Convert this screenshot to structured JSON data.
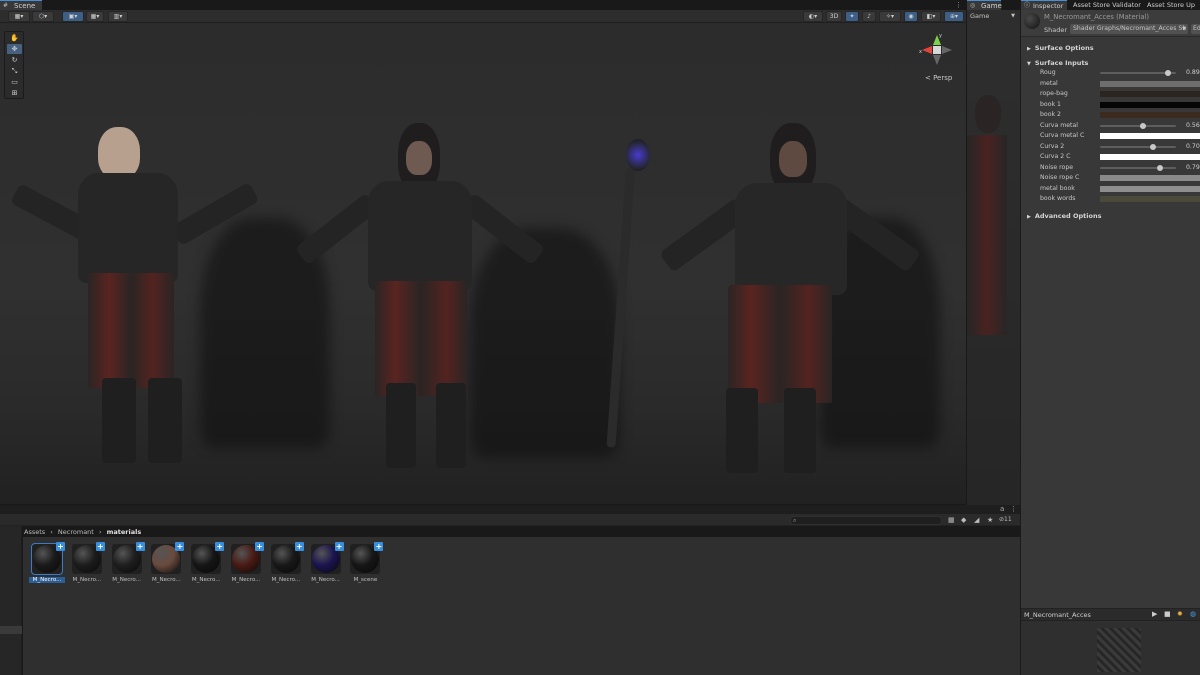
{
  "scene_tab": {
    "label": "Scene"
  },
  "game_tab": {
    "label": "Game",
    "sub_label": "Game"
  },
  "scene_toolbar": {
    "mode_2d_label": "3D"
  },
  "viewport": {
    "projection_label": "< Persp",
    "gizmo_axes": [
      "x",
      "y",
      "z"
    ]
  },
  "inspector": {
    "tabs": [
      "Inspector",
      "Asset Store Validator",
      "Asset Store Up"
    ],
    "material_name": "M_Necromant_Acces (Material)",
    "shader_label": "Shader",
    "shader_value": "Shader Graphs/Necromant_Acces Sh",
    "edit_label": "Ed",
    "sections": {
      "surface_options": "Surface Options",
      "surface_inputs": "Surface Inputs",
      "advanced_options": "Advanced Options"
    },
    "properties": [
      {
        "label": "Roug",
        "kind": "slider",
        "value": "0.89",
        "fraction": 0.89
      },
      {
        "label": "metal",
        "kind": "color",
        "color": "#6e6e6e"
      },
      {
        "label": "rope-bag",
        "kind": "color",
        "color": "#2b2520"
      },
      {
        "label": "book 1",
        "kind": "color",
        "color": "#050505"
      },
      {
        "label": "book 2",
        "kind": "color",
        "color": "#3b2a1e"
      },
      {
        "label": "Curva metal",
        "kind": "slider",
        "value": "0.56",
        "fraction": 0.56
      },
      {
        "label": "Curva metal C",
        "kind": "color",
        "color": "#ffffff"
      },
      {
        "label": "Curva 2",
        "kind": "slider",
        "value": "0.70",
        "fraction": 0.7
      },
      {
        "label": "Curva 2 C",
        "kind": "color",
        "color": "#ffffff"
      },
      {
        "label": "Noise rope",
        "kind": "slider",
        "value": "0.79",
        "fraction": 0.79
      },
      {
        "label": "Noise rope C",
        "kind": "color",
        "color": "#8a8a8a"
      },
      {
        "label": "metal book",
        "kind": "color",
        "color": "#8e8e8e"
      },
      {
        "label": "book words",
        "kind": "color",
        "color": "#4a4a3a"
      }
    ],
    "preview_title": "M_Necromant_Acces"
  },
  "project": {
    "breadcrumb": [
      "Assets",
      "Necromant",
      "materials"
    ],
    "asset_count": "11",
    "assets": [
      {
        "label": "M_Necro...",
        "color": "#1a1a1a",
        "selected": true
      },
      {
        "label": "M_Necro...",
        "color": "#1c1c1c",
        "selected": false
      },
      {
        "label": "M_Necro...",
        "color": "#1e1e1e",
        "selected": false
      },
      {
        "label": "M_Necro...",
        "color": "#6a4a3e",
        "selected": false
      },
      {
        "label": "M_Necro...",
        "color": "#151515",
        "selected": false
      },
      {
        "label": "M_Necro...",
        "color": "#4a1a14",
        "selected": false
      },
      {
        "label": "M_Necro...",
        "color": "#181818",
        "selected": false
      },
      {
        "label": "M_Necro...",
        "color": "#1c1450",
        "selected": false
      },
      {
        "label": "M_scene",
        "color": "#161616",
        "selected": false
      }
    ]
  }
}
